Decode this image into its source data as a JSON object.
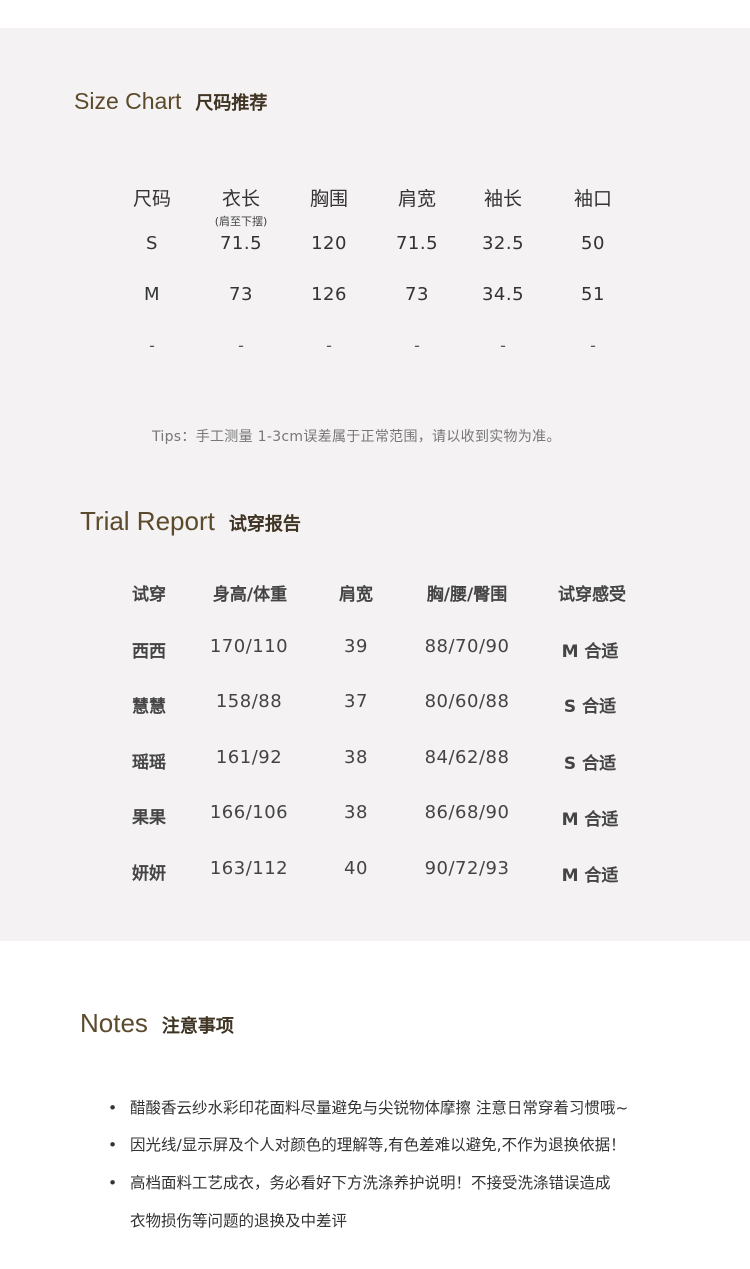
{
  "size_chart": {
    "title_en": "Size Chart",
    "title_cn": "尺码推荐",
    "headers": [
      "尺码",
      "衣长",
      "胸围",
      "肩宽",
      "袖长",
      "袖口"
    ],
    "header_note": "(肩至下摆)",
    "rows": [
      [
        "S",
        "71.5",
        "120",
        "71.5",
        "32.5",
        "50"
      ],
      [
        "M",
        "73",
        "126",
        "73",
        "34.5",
        "51"
      ],
      [
        "-",
        "-",
        "-",
        "-",
        "-",
        "-"
      ]
    ],
    "tips": "Tips：手工测量 1-3cm误差属于正常范围，请以收到实物为准。"
  },
  "trial_report": {
    "title_en": "Trial Report",
    "title_cn": "试穿报告",
    "headers": [
      "试穿",
      "身高/体重",
      "肩宽",
      "胸/腰/臀围",
      "试穿感受"
    ],
    "rows": [
      [
        "西西",
        "170/110",
        "39",
        "88/70/90",
        "M 合适"
      ],
      [
        "慧慧",
        "158/88",
        "37",
        "80/60/88",
        "S 合适"
      ],
      [
        "瑶瑶",
        "161/92",
        "38",
        "84/62/88",
        "S 合适"
      ],
      [
        "果果",
        "166/106",
        "38",
        "86/68/90",
        "M 合适"
      ],
      [
        "妍妍",
        "163/112",
        "40",
        "90/72/93",
        "M 合适"
      ]
    ]
  },
  "notes": {
    "title_en": "Notes",
    "title_cn": "注意事项",
    "bullet": "•",
    "items": [
      "醋酸香云纱水彩印花面料尽量避免与尖锐物体摩擦 注意日常穿着习惯哦~",
      "因光线/显示屏及个人对颜色的理解等,有色差难以避免,不作为退换依据！",
      "高档面料工艺成衣，务必看好下方洗涤养护说明！不接受洗涤错误造成"
    ],
    "item3_cont": "衣物损伤等问题的退换及中差评"
  }
}
